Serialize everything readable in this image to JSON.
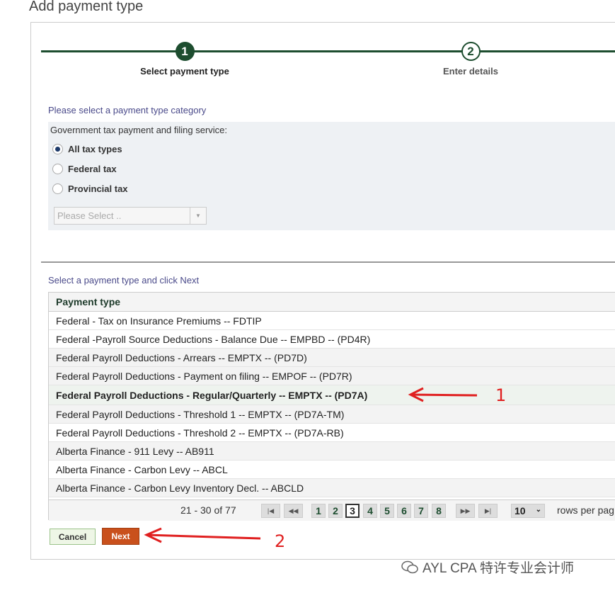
{
  "page_title": "Add payment type",
  "steps": [
    {
      "number": "1",
      "label": "Select payment type"
    },
    {
      "number": "2",
      "label": "Enter details"
    }
  ],
  "category": {
    "heading": "Please select a payment type category",
    "label": "Government tax payment and filing service:",
    "options": [
      "All tax types",
      "Federal tax",
      "Provincial tax"
    ],
    "selected_option": "All tax types",
    "select_placeholder": "Please Select .."
  },
  "payment": {
    "heading": "Select a payment type and click Next",
    "column_header": "Payment type",
    "rows": [
      "Federal - Tax on Insurance Premiums -- FDTIP",
      "Federal -Payroll Source Deductions - Balance Due -- EMPBD -- (PD4R)",
      "Federal Payroll Deductions - Arrears -- EMPTX -- (PD7D)",
      "Federal Payroll Deductions - Payment on filing -- EMPOF -- (PD7R)",
      "Federal Payroll Deductions - Regular/Quarterly -- EMPTX -- (PD7A)",
      "Federal Payroll Deductions - Threshold 1 -- EMPTX -- (PD7A-TM)",
      "Federal Payroll Deductions - Threshold 2 -- EMPTX -- (PD7A-RB)",
      "Alberta Finance - 911 Levy -- AB911",
      "Alberta Finance - Carbon Levy -- ABCL",
      "Alberta Finance - Carbon Levy Inventory Decl. -- ABCLD"
    ],
    "selected_row": "Federal Payroll Deductions - Regular/Quarterly -- EMPTX -- (PD7A)"
  },
  "pager": {
    "info": "21 - 30 of 77",
    "pages": [
      "1",
      "2",
      "3",
      "4",
      "5",
      "6",
      "7",
      "8"
    ],
    "current_page": "3",
    "rows_value": "10",
    "rows_label": "rows per pag"
  },
  "buttons": {
    "cancel": "Cancel",
    "next": "Next"
  },
  "annotations": {
    "arrow1_label": "1",
    "arrow2_label": "2"
  },
  "watermark": "AYL CPA 特许专业会计师",
  "colors": {
    "brand_green": "#1d4d2f",
    "next_button": "#c9501c",
    "annotation_red": "#e02020"
  }
}
